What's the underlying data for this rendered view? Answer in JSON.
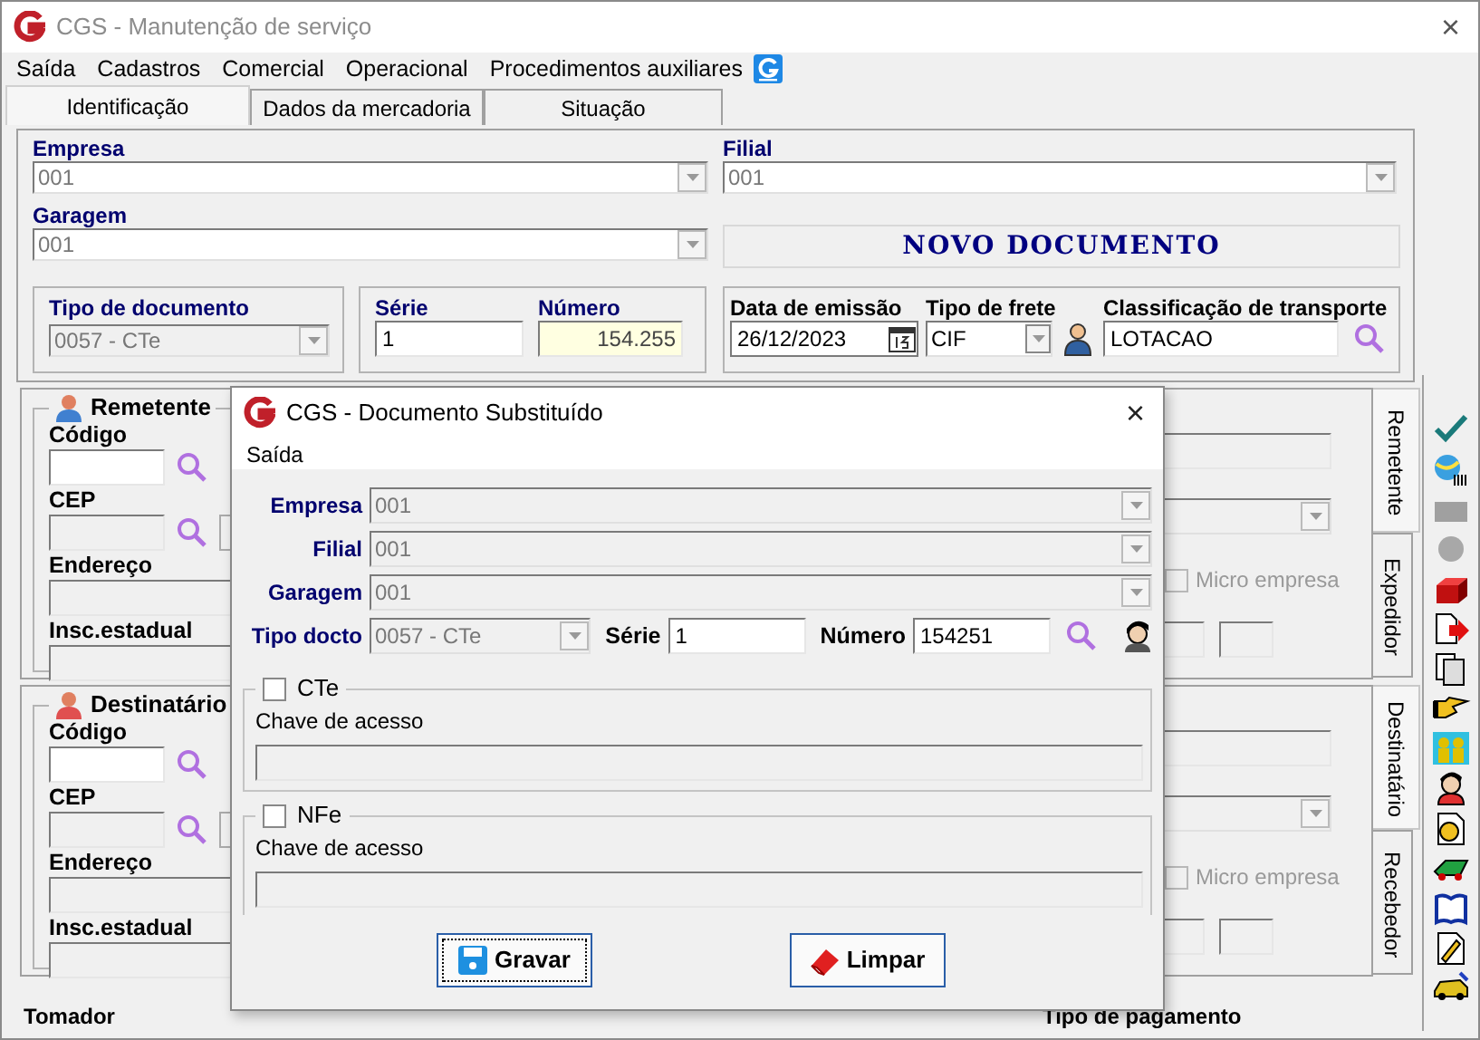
{
  "window": {
    "title": "CGS - Manutenção de serviço",
    "close": "×"
  },
  "menu": [
    "Saída",
    "Cadastros",
    "Comercial",
    "Operacional",
    "Procedimentos auxiliares"
  ],
  "tabs": [
    {
      "label": "Identificação",
      "selected": true
    },
    {
      "label": "Dados da mercadoria",
      "selected": false
    },
    {
      "label": "Situação",
      "selected": false
    }
  ],
  "identificacao": {
    "empresa": {
      "label": "Empresa",
      "value": "001"
    },
    "filial": {
      "label": "Filial",
      "value": "001"
    },
    "garagem": {
      "label": "Garagem",
      "value": "001"
    },
    "status": "NOVO DOCUMENTO",
    "tipo_documento": {
      "label": "Tipo de documento",
      "value": "0057 - CTe"
    },
    "serie": {
      "label": "Série",
      "value": "1"
    },
    "numero": {
      "label": "Número",
      "value": "154.255"
    },
    "data_emissao": {
      "label": "Data de emissão",
      "value": "26/12/2023"
    },
    "tipo_frete": {
      "label": "Tipo de frete",
      "value": "CIF"
    },
    "classificacao": {
      "label": "Classificação de transporte",
      "value": "LOTACAO"
    }
  },
  "parties": [
    {
      "title": "Remetente",
      "fields": [
        "Código",
        "CEP",
        "Endereço",
        "Insc.estadual"
      ],
      "micro_empresa": {
        "label": "Micro empresa",
        "checked": false
      },
      "side_tabs": [
        {
          "label": "Remetente",
          "selected": true
        },
        {
          "label": "Expedidor",
          "selected": false
        }
      ]
    },
    {
      "title": "Destinatário",
      "fields": [
        "Código",
        "CEP",
        "Endereço",
        "Insc.estadual"
      ],
      "micro_empresa": {
        "label": "Micro empresa",
        "checked": false
      },
      "side_tabs": [
        {
          "label": "Destinatário",
          "selected": true
        },
        {
          "label": "Recebedor",
          "selected": false
        }
      ]
    }
  ],
  "bottom": {
    "tomador": "Tomador",
    "tipo_pagamento": "Tipo de pagamento"
  },
  "dialog": {
    "title": "CGS - Documento Substituído",
    "close": "×",
    "menu": [
      "Saída"
    ],
    "fields": [
      {
        "label": "Empresa",
        "value": "001"
      },
      {
        "label": "Filial",
        "value": "001"
      },
      {
        "label": "Garagem",
        "value": "001"
      }
    ],
    "tipo_docto": {
      "label": "Tipo docto",
      "value": "0057 - CTe"
    },
    "serie": {
      "label": "Série",
      "value": "1"
    },
    "numero": {
      "label": "Número",
      "value": "154251"
    },
    "groups": [
      {
        "label": "CTe",
        "checked": false,
        "field_label": "Chave de acesso"
      },
      {
        "label": "NFe",
        "checked": false,
        "field_label": "Chave de acesso"
      }
    ],
    "buttons": [
      {
        "label": "Gravar",
        "kind": "save",
        "focused": true
      },
      {
        "label": "Limpar",
        "kind": "clear",
        "focused": false
      }
    ]
  }
}
